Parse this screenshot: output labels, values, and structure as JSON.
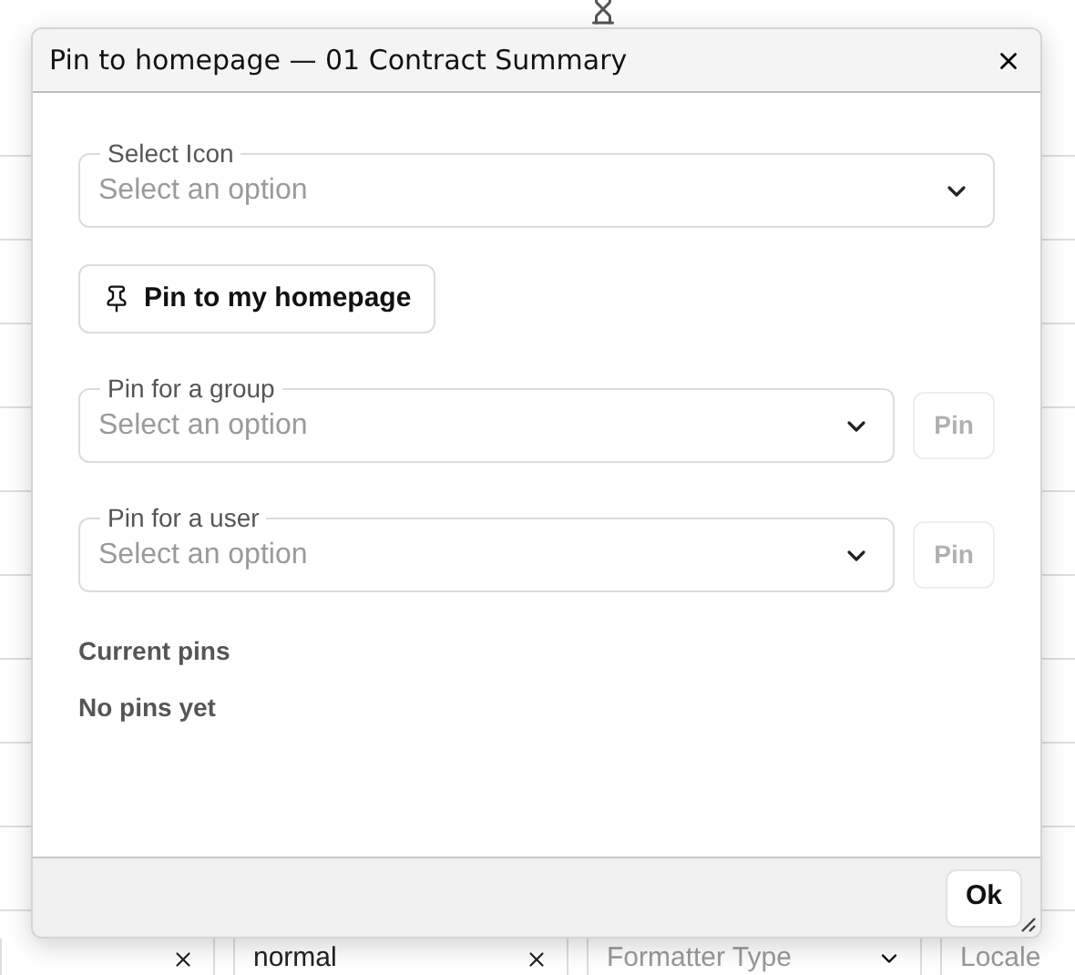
{
  "background_fields": [
    {
      "kind": "clearable"
    },
    {
      "kind": "clearable",
      "value": "normal"
    },
    {
      "kind": "select",
      "placeholder": "Formatter Type"
    },
    {
      "kind": "text",
      "placeholder": "Locale"
    }
  ],
  "dialog": {
    "title": "Pin to homepage — 01 Contract Summary",
    "icon_select": {
      "label": "Select Icon",
      "placeholder": "Select an option"
    },
    "pin_mine_button": "Pin to my homepage",
    "targets": [
      {
        "label": "Pin for a group",
        "placeholder": "Select an option",
        "button": "Pin",
        "disabled": true
      },
      {
        "label": "Pin for a user",
        "placeholder": "Select an option",
        "button": "Pin",
        "disabled": true
      }
    ],
    "current_pins_heading": "Current pins",
    "empty_text": "No pins yet",
    "ok_button": "Ok"
  }
}
